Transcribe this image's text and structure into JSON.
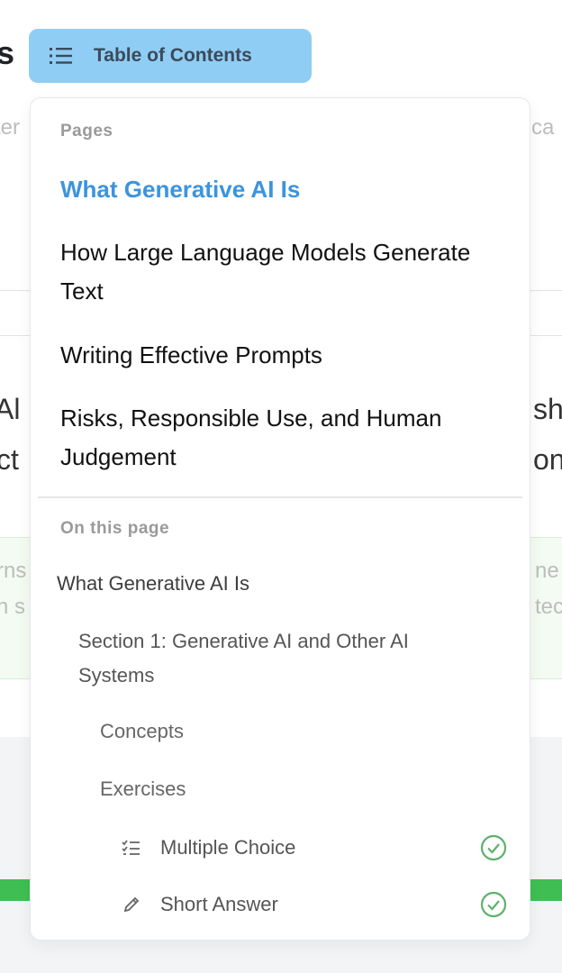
{
  "background": {
    "heading_fragment": "s",
    "text_left_1": "ter",
    "text_right_1": "ca",
    "big_left_1": "Al i",
    "big_left_2": "ct",
    "big_right_1": "sh",
    "big_right_2": "on",
    "green_left_1": "rns",
    "green_left_2": "n s",
    "green_right_1": "ne",
    "green_right_2": "tec"
  },
  "toc_button": {
    "label": "Table of Contents",
    "background": "#90cdf4"
  },
  "toc_panel": {
    "pages_label": "Pages",
    "pages": [
      {
        "label": "What Generative AI Is",
        "active": true
      },
      {
        "label": "How Large Language Models Generate Text",
        "active": false
      },
      {
        "label": "Writing Effective Prompts",
        "active": false
      },
      {
        "label": "Risks, Responsible Use, and Human Judgement",
        "active": false
      }
    ],
    "on_this_page_label": "On this page",
    "on_this_page": {
      "page_title": "What Generative AI Is",
      "section": "Section 1: Generative AI and Other AI Systems",
      "concepts": "Concepts",
      "exercises": "Exercises",
      "exercise_items": [
        {
          "label": "Multiple Choice",
          "icon": "checklist-icon",
          "completed": true
        },
        {
          "label": "Short Answer",
          "icon": "pencil-icon",
          "completed": true
        }
      ]
    },
    "accent_color": "#3b94de",
    "complete_color": "#5cb26b"
  }
}
